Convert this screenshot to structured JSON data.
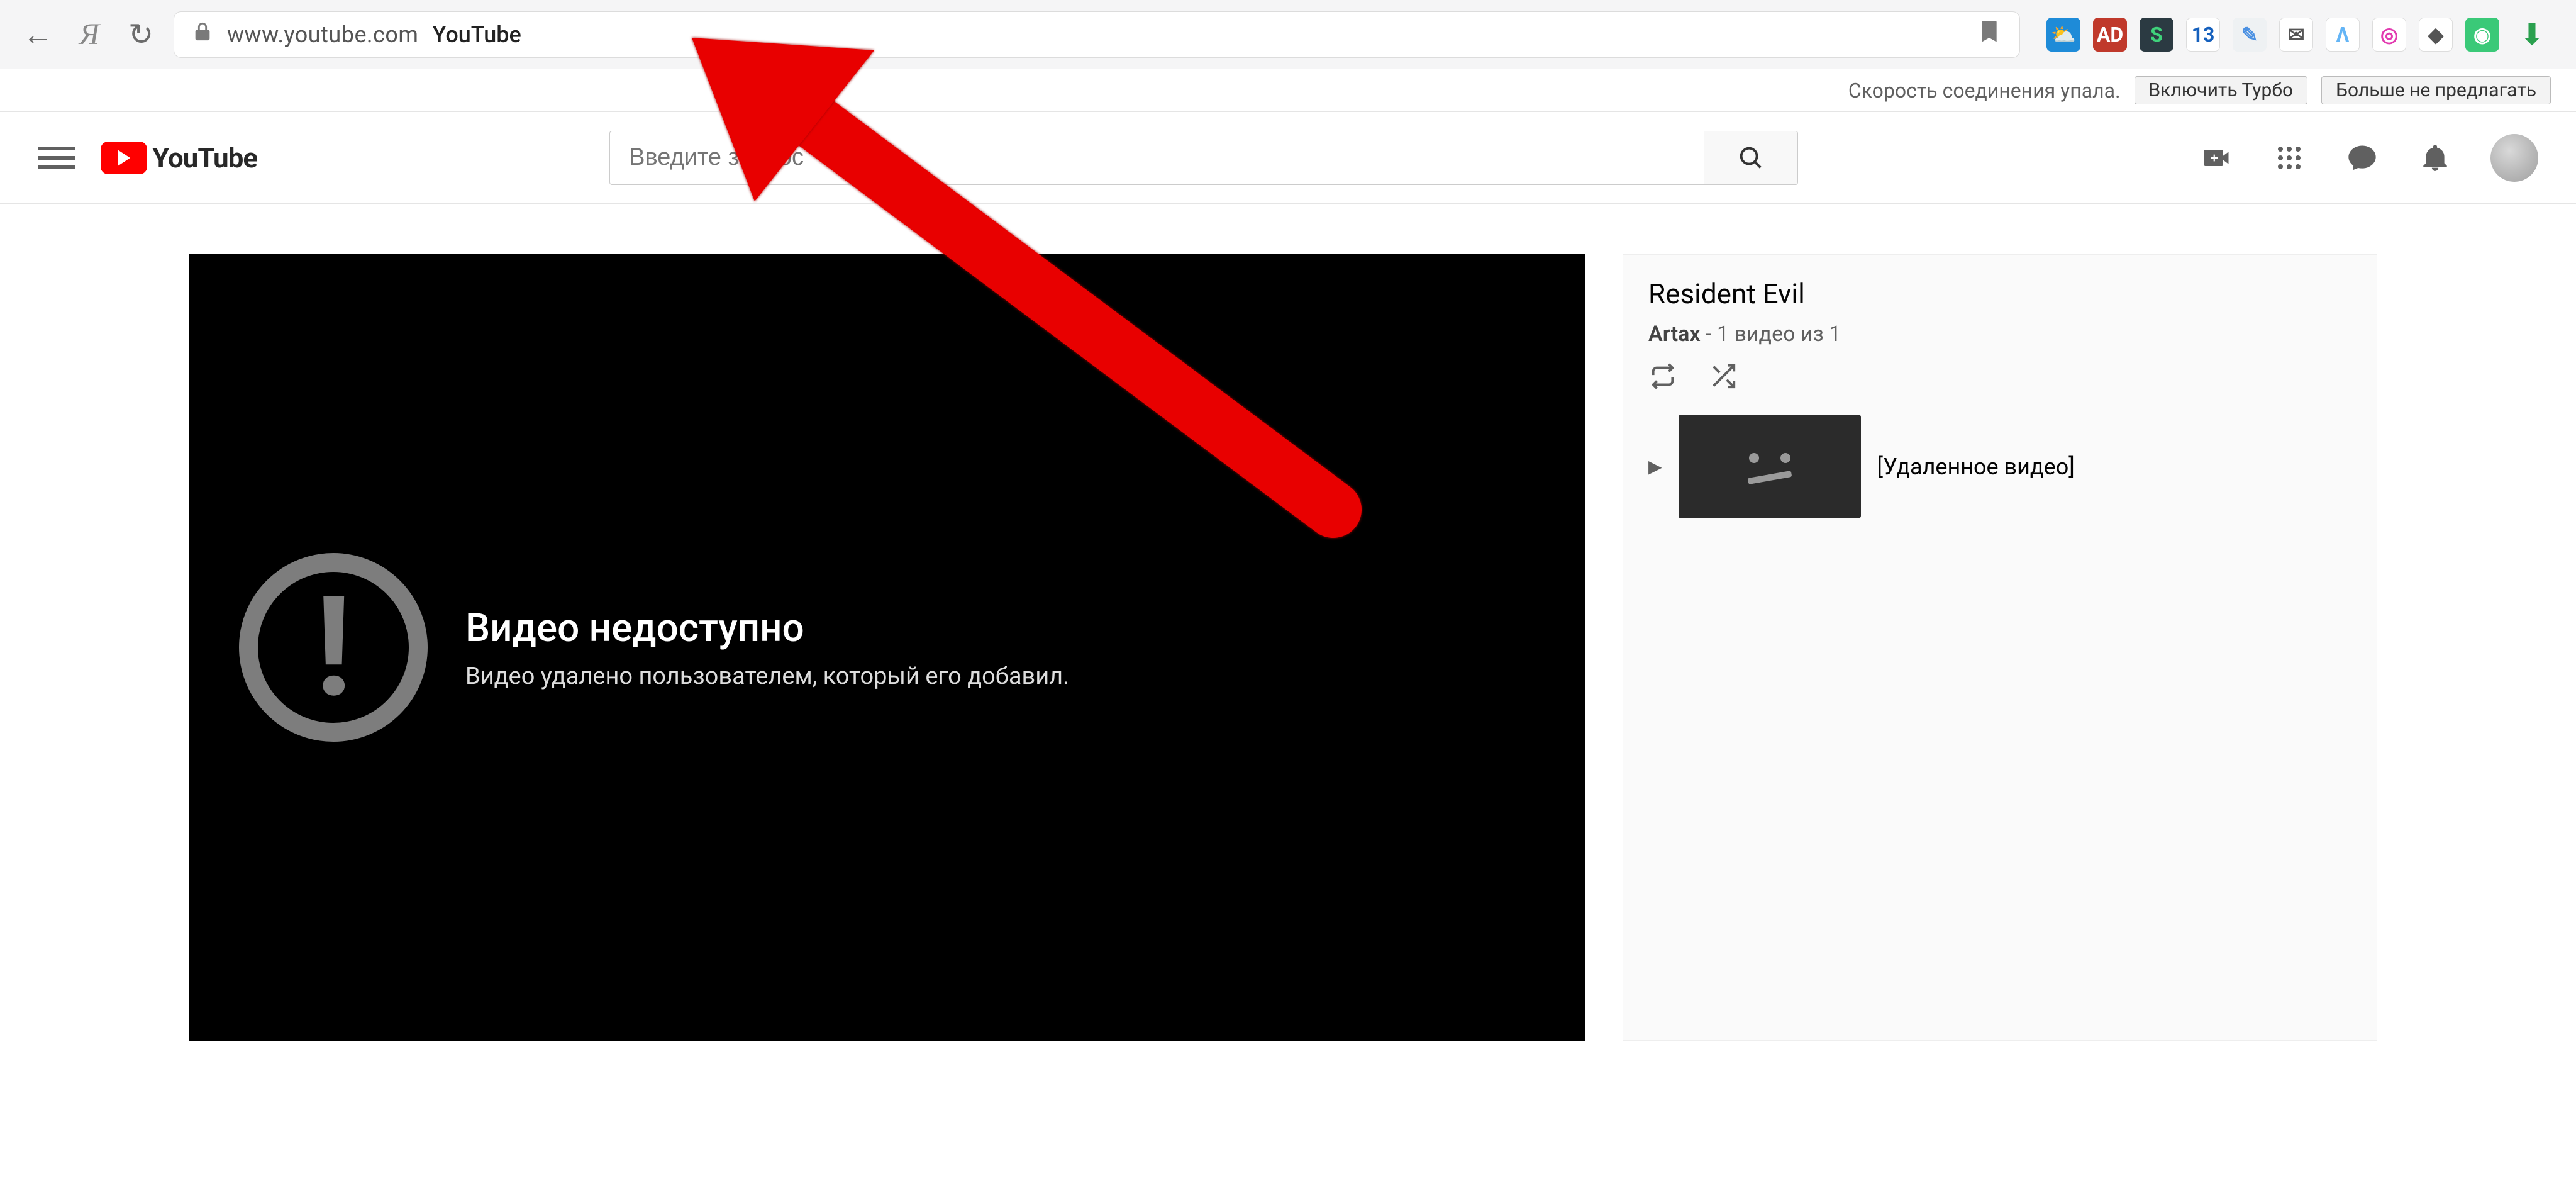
{
  "browser": {
    "url": "www.youtube.com",
    "page_title": "YouTube",
    "extension_badges": [
      {
        "bg": "#1e8bd8",
        "fg": "#fff",
        "txt": "⛅"
      },
      {
        "bg": "#c0392b",
        "fg": "#fff",
        "txt": "AD"
      },
      {
        "bg": "#2b3a42",
        "fg": "#3fd27b",
        "txt": "S"
      },
      {
        "bg": "#ffffff",
        "fg": "#1560bd",
        "txt": "13"
      },
      {
        "bg": "#eef1f3",
        "fg": "#4a90e2",
        "txt": "✎"
      },
      {
        "bg": "#ffffff",
        "fg": "#555555",
        "txt": "✉"
      },
      {
        "bg": "#ffffff",
        "fg": "#64b5f6",
        "txt": "Λ"
      },
      {
        "bg": "#ffffff",
        "fg": "#e23bb0",
        "txt": "◎"
      },
      {
        "bg": "#ffffff",
        "fg": "#555555",
        "txt": "◆"
      },
      {
        "bg": "#3ac978",
        "fg": "#ffffff",
        "txt": "◉"
      }
    ]
  },
  "turbo": {
    "message": "Скорость соединения упала.",
    "enable_label": "Включить Турбо",
    "dismiss_label": "Больше не предлагать"
  },
  "masthead": {
    "logo_text": "YouTube",
    "search_placeholder": "Введите запрос"
  },
  "player_error": {
    "title": "Видео недоступно",
    "subtitle": "Видео удалено пользователем, который его добавил."
  },
  "playlist": {
    "title": "Resident Evil",
    "owner": "Artax",
    "count_text": "1 видео из 1",
    "item_label": "[Удаленное видео]"
  }
}
